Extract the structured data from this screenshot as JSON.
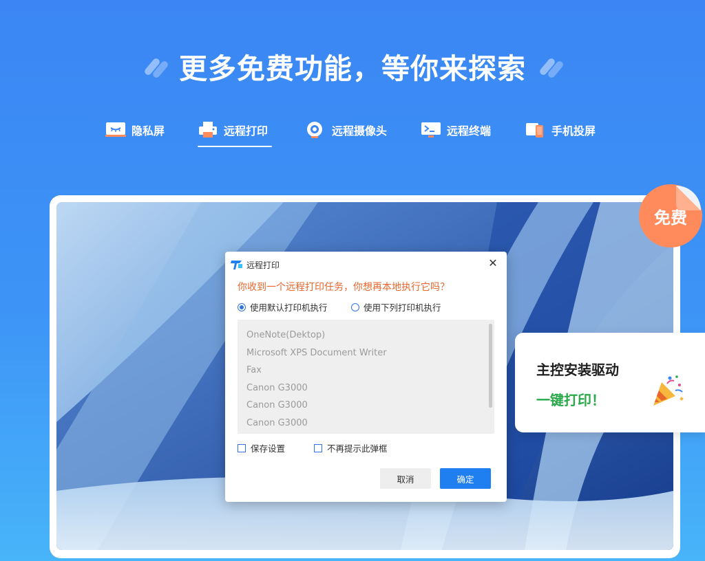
{
  "headline": "更多免费功能，等你来探索",
  "tabs": [
    {
      "label": "隐私屏",
      "icon": "privacy-screen-icon"
    },
    {
      "label": "远程打印",
      "icon": "printer-icon",
      "active": true
    },
    {
      "label": "远程摄像头",
      "icon": "camera-icon"
    },
    {
      "label": "远程终端",
      "icon": "terminal-icon"
    },
    {
      "label": "手机投屏",
      "icon": "phone-cast-icon"
    }
  ],
  "free_badge": "免费",
  "dialog": {
    "title": "远程打印",
    "question": "你收到一个远程打印任务，你想再本地执行它吗？",
    "radio_default": "使用默认打印机执行",
    "radio_list": "使用下列打印机执行",
    "printers": [
      "OneNote(Dektop)",
      "Microsoft XPS Document Writer",
      "Fax",
      "Canon G3000",
      "Canon G3000",
      "Canon G3000"
    ],
    "checkbox_save": "保存设置",
    "checkbox_noprompt": "不再提示此弹框",
    "cancel": "取消",
    "ok": "确定"
  },
  "side_card": {
    "line1": "主控安装驱动",
    "line2": "一键打印！"
  },
  "colors": {
    "background": "#3d8ef5",
    "accent_blue": "#1f7ef0",
    "question_orange": "#e8662c",
    "badge_orange": "#ff8a5c",
    "green": "#2aa84a"
  }
}
